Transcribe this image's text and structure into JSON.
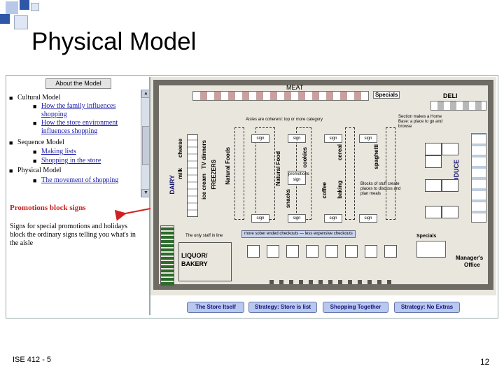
{
  "slide": {
    "title": "Physical Model",
    "footer_left": "ISE 412 - 5",
    "page_number": "12"
  },
  "outline_pane": {
    "tab_label": "About the Model",
    "items": [
      {
        "text": "Cultural Model",
        "level": 1,
        "link": false
      },
      {
        "text": "How the family influences shopping",
        "level": 2,
        "link": true
      },
      {
        "text": "How the store environment influences shopping",
        "level": 2,
        "link": true
      },
      {
        "text": "Sequence Model",
        "level": 1,
        "link": false
      },
      {
        "text": "Making lists",
        "level": 2,
        "link": true
      },
      {
        "text": "Shopping in the store",
        "level": 2,
        "link": true
      },
      {
        "text": "Physical Model",
        "level": 1,
        "link": false
      },
      {
        "text": "The movement of shopping",
        "level": 2,
        "link": true
      }
    ],
    "promo_title": "Promotions block signs",
    "promo_body": "Signs for special promotions and holidays block the ordinary signs telling you what's in the aisle"
  },
  "floor_plan": {
    "meat_label": "MEAT",
    "specials_label": "Specials",
    "deli_label": "DELI",
    "aisle_note": "Aisles are coherent: top or more category",
    "section_note": "Section makes a Home Base: a place to go and browse",
    "produce_label": "PRODUCE",
    "dairy_label": "DAIRY",
    "milk_label": "milk",
    "cheese_label": "cheese",
    "icecream_label": "ice cream",
    "tv_dinners_label": "TV dinners",
    "freezers_label": "FREEZERS",
    "natural_foods_label": "Natural Foods",
    "natural_food_label": "Natural Food",
    "snacks_label": "snacks",
    "cookies_label": "cookies",
    "cereal_label": "cereal",
    "coffee_label": "coffee",
    "baking_label": "baking",
    "spaghetti_label": "spaghetti",
    "promo_sign_label": "promotions sign",
    "sign_label": "sign",
    "blocks_note": "Blocks of stuff create places to discuss and plan meals",
    "checkout_note": "more sober ended checkouts — less expensive checkouts",
    "people_note": "The only staff in line",
    "liquor_label": "LIQUOR/",
    "bakery_label": "BAKERY",
    "specials_right_label": "Specials",
    "manager_label": "Manager's",
    "office_label": "Office"
  },
  "buttons": [
    {
      "label": "The Store Itself"
    },
    {
      "label": "Strategy: Store is list"
    },
    {
      "label": "Shopping Together"
    },
    {
      "label": "Strategy: No Extras"
    }
  ],
  "colors": {
    "promo_red": "#c82020",
    "link_blue": "#1a1aa8",
    "button_bg": "#b9c8ee",
    "corner_blue": "#2f57a8",
    "corner_light": "#b8c8e8"
  }
}
